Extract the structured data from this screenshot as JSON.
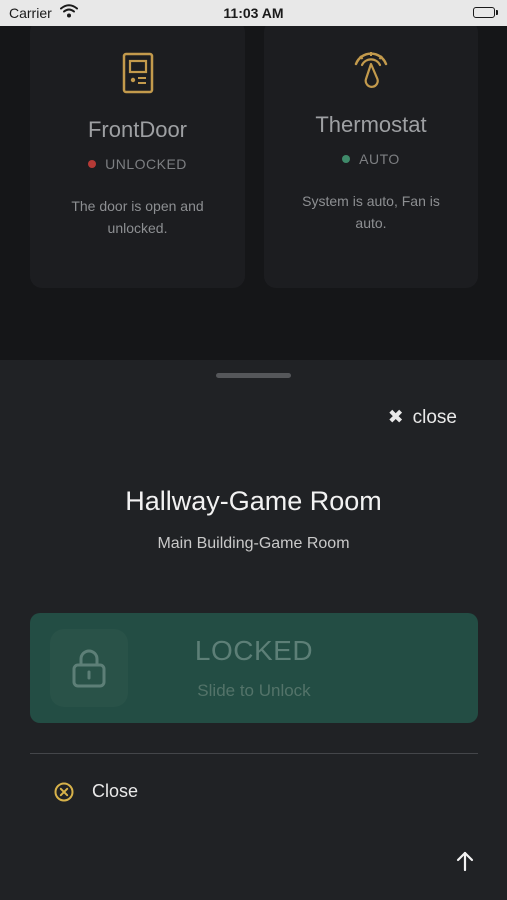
{
  "status_bar": {
    "carrier": "Carrier",
    "time": "11:03 AM"
  },
  "cards": [
    {
      "name": "FrontDoor",
      "state": "UNLOCKED",
      "state_color": "#b53a36",
      "description": "The door is open and unlocked.",
      "icon": "door-panel-icon"
    },
    {
      "name": "Thermostat",
      "state": "AUTO",
      "state_color": "#3f8a6a",
      "description": "System is auto, Fan is auto.",
      "icon": "thermostat-gauge-icon"
    }
  ],
  "colors": {
    "accent_gold": "#c39a4c",
    "lock_green": "#234d44"
  },
  "sheet": {
    "close_top_label": "close",
    "title": "Hallway-Game Room",
    "subtitle": "Main Building-Game Room",
    "slider": {
      "status": "LOCKED",
      "hint": "Slide to Unlock"
    },
    "close_row_label": "Close"
  }
}
